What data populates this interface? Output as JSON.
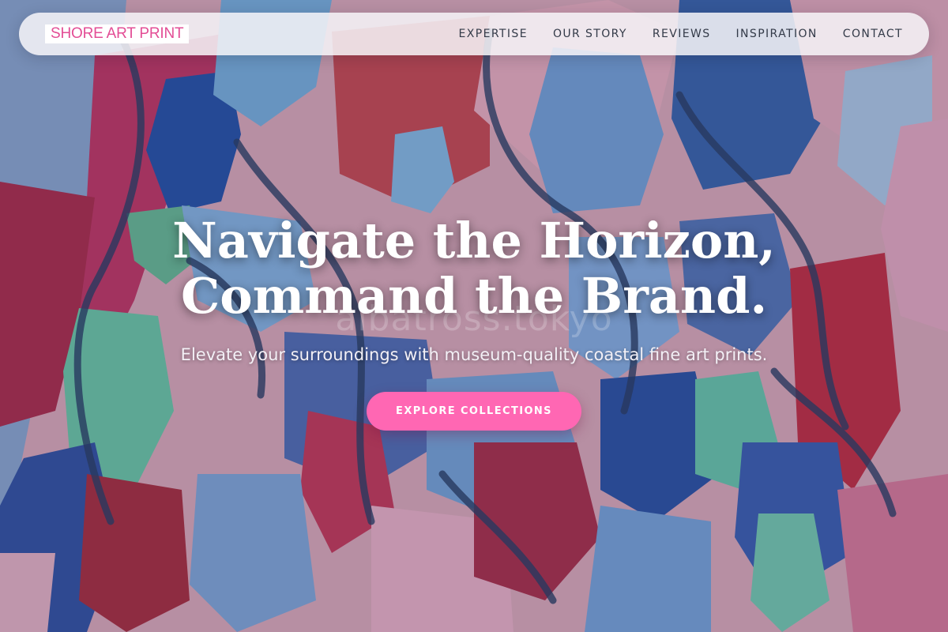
{
  "brand": {
    "logo_text": "SHORE ART PRINT",
    "color": "#e34d95"
  },
  "nav": {
    "items": [
      {
        "label": "EXPERTISE"
      },
      {
        "label": "OUR STORY"
      },
      {
        "label": "REVIEWS"
      },
      {
        "label": "INSPIRATION"
      },
      {
        "label": "CONTACT"
      }
    ]
  },
  "hero": {
    "headline_line1": "Navigate the Horizon,",
    "headline_line2": "Command the Brand.",
    "subtitle": "Elevate your surroundings with museum-quality coastal fine art prints.",
    "cta_label": "EXPLORE COLLECTIONS",
    "watermark": "albatross.tokyo",
    "background": "abstract painting in pink, red, blue and teal",
    "cta_color": "#ff67b3"
  }
}
